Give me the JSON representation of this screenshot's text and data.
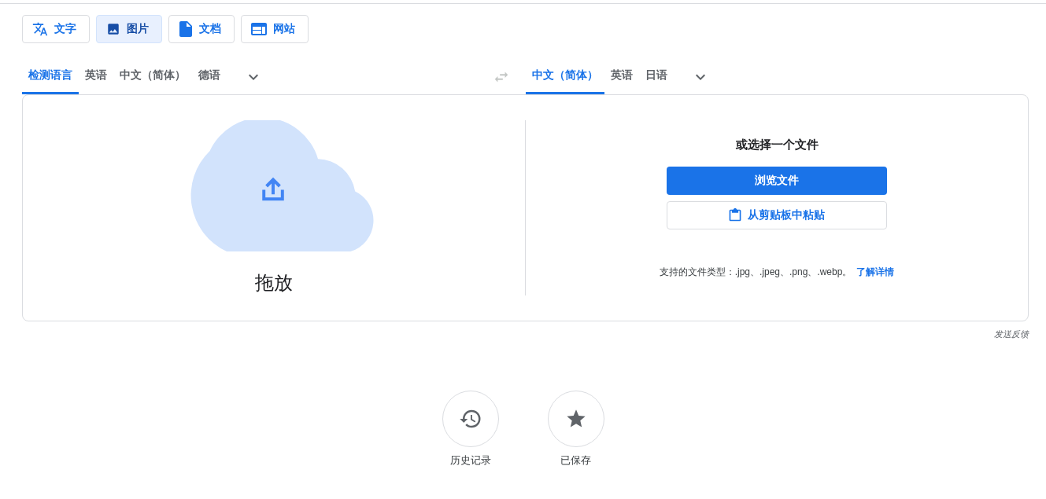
{
  "modes": [
    {
      "kind": "text",
      "label": "文字",
      "selected": false
    },
    {
      "kind": "image",
      "label": "图片",
      "selected": true
    },
    {
      "kind": "document",
      "label": "文档",
      "selected": false
    },
    {
      "kind": "website",
      "label": "网站",
      "selected": false
    }
  ],
  "source_languages": [
    {
      "label": "检测语言",
      "selected": true
    },
    {
      "label": "英语",
      "selected": false
    },
    {
      "label": "中文（简体）",
      "selected": false
    },
    {
      "label": "德语",
      "selected": false
    }
  ],
  "target_languages": [
    {
      "label": "中文（简体）",
      "selected": true
    },
    {
      "label": "英语",
      "selected": false
    },
    {
      "label": "日语",
      "selected": false
    }
  ],
  "drop_zone": {
    "label": "拖放"
  },
  "file_picker": {
    "heading": "或选择一个文件",
    "browse_button": "浏览文件",
    "paste_button": "从剪贴板中粘贴",
    "supported_types": "支持的文件类型：.jpg、.jpeg、.png、.webp。",
    "learn_more": "了解详情"
  },
  "feedback": "发送反馈",
  "shortcuts": [
    {
      "kind": "history",
      "label": "历史记录"
    },
    {
      "kind": "saved",
      "label": "已保存"
    }
  ]
}
